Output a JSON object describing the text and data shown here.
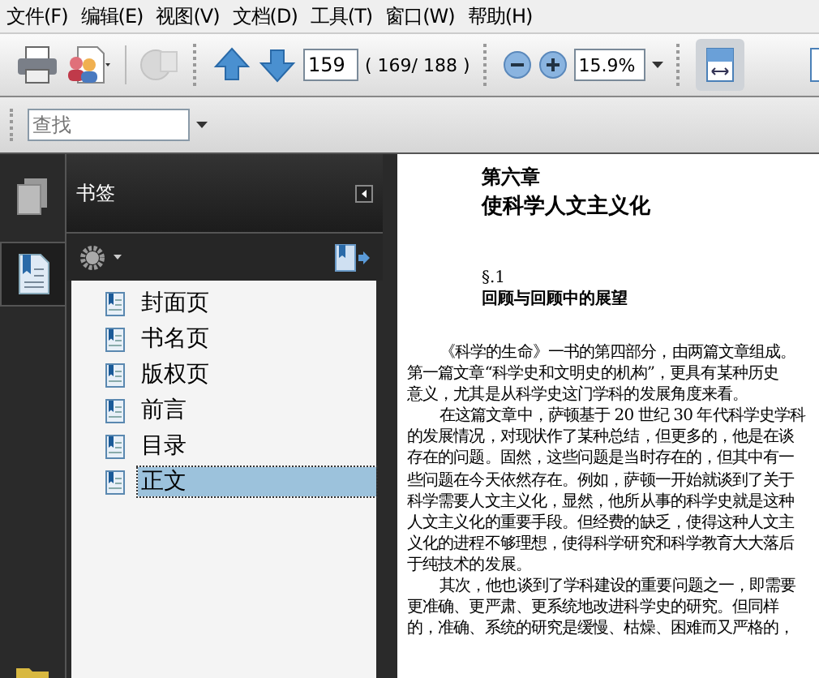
{
  "menu": [
    {
      "label": "文件(F)"
    },
    {
      "label": "编辑(E)"
    },
    {
      "label": "视图(V)"
    },
    {
      "label": "文档(D)"
    },
    {
      "label": "工具(T)"
    },
    {
      "label": "窗口(W)"
    },
    {
      "label": "帮助(H)"
    }
  ],
  "toolbar": {
    "page_number": "159",
    "page_count": "( 169/ 188 )",
    "zoom": "15.9%"
  },
  "find": {
    "placeholder": "查找"
  },
  "bookmarks": {
    "title": "书签",
    "items": [
      {
        "label": "封面页",
        "selected": false
      },
      {
        "label": "书名页",
        "selected": false
      },
      {
        "label": "版权页",
        "selected": false
      },
      {
        "label": "前言",
        "selected": false
      },
      {
        "label": "目录",
        "selected": false
      },
      {
        "label": "正文",
        "selected": true
      }
    ]
  },
  "document": {
    "chapter": "第六章",
    "title": "使科学人文主义化",
    "section": "§.1",
    "section_title": "回顾与回顾中的展望",
    "paragraphs": [
      [
        "《科学的生命》一书的第四部分，由两篇文章组成。",
        "第一篇文章“科学史和文明史的机构”，更具有某种历史",
        "意义，尤其是从科学史这门学科的发展角度来看。"
      ],
      [
        "在这篇文章中，萨顿基于 20 世纪 30 年代科学史学科",
        "的发展情况，对现状作了某种总结，但更多的，他是在谈",
        "存在的问题。固然，这些问题是当时存在的，但其中有一",
        "些问题在今天依然存在。例如，萨顿一开始就谈到了关于",
        "科学需要人文主义化，显然，他所从事的科学史就是这种",
        "人文主义化的重要手段。但经费的缺乏，使得这种人文主",
        "义化的进程不够理想，使得科学研究和科学教育大大落后",
        "于纯技术的发展。"
      ],
      [
        "其次，他也谈到了学科建设的重要问题之一，即需要",
        "更准确、更严肃、更系统地改进科学史的研究。但同样",
        "的，准确、系统的研究是缓慢、枯燥、困难而又严格的，"
      ]
    ]
  }
}
